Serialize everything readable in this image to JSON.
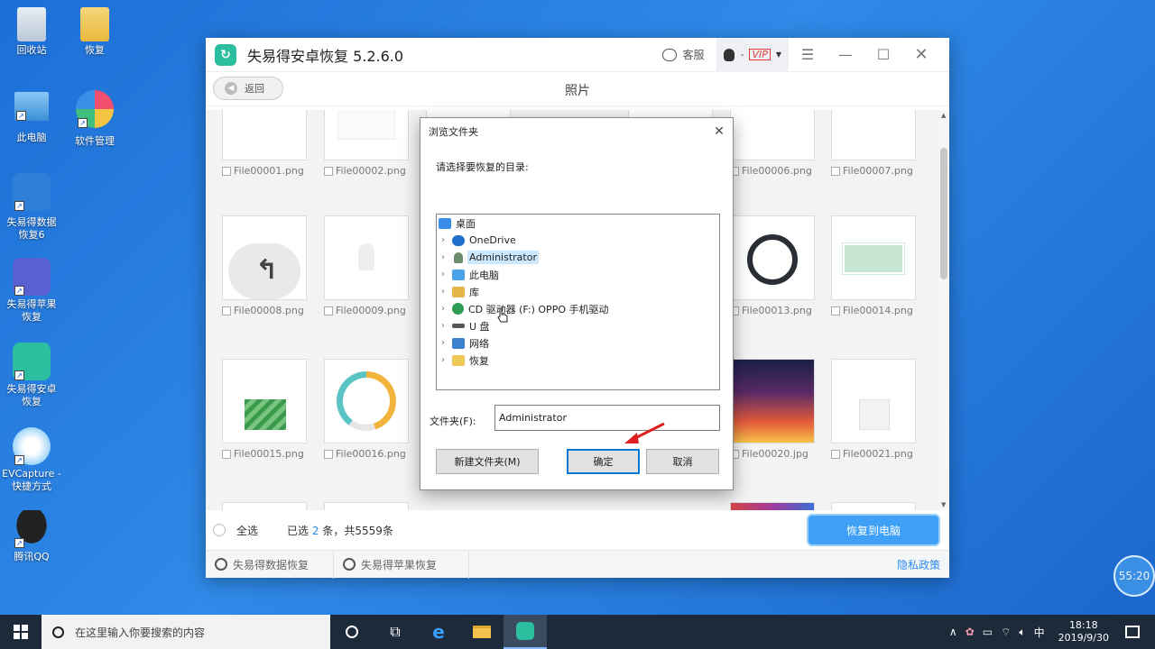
{
  "desktop": {
    "icons": [
      {
        "label": "回收站",
        "icon": "recycle-bin-icon"
      },
      {
        "label": "恢复",
        "icon": "folder-icon"
      },
      {
        "label": "此电脑",
        "icon": "computer-icon"
      },
      {
        "label": "软件管理",
        "icon": "software-manager-icon"
      },
      {
        "label": "失易得数据\n恢复6",
        "icon": "data-recovery-icon"
      },
      {
        "label": "失易得苹果\n恢复",
        "icon": "apple-recovery-icon"
      },
      {
        "label": "失易得安卓\n恢复",
        "icon": "android-recovery-icon"
      },
      {
        "label": "EVCapture -\n快捷方式",
        "icon": "evcapture-icon"
      },
      {
        "label": "腾讯QQ",
        "icon": "qq-icon"
      }
    ]
  },
  "app": {
    "title": "失易得安卓恢复  5.2.6.0",
    "service_label": "客服",
    "vip_label": "VIP",
    "user_dash": "-",
    "back_label": "返回",
    "page_title": "照片",
    "files": [
      "File00001.png",
      "File00002.png",
      "File00006.png",
      "File00007.png",
      "File00008.png",
      "File00009.png",
      "File00013.png",
      "File00014.png",
      "File00015.png",
      "File00016.png",
      "File00020.jpg",
      "File00021.png"
    ],
    "select_all_label": "全选",
    "selected_prefix": "已选",
    "selected_count": "2",
    "selected_suffix": "条，共5559条",
    "recover_button": "恢复到电脑",
    "footer_links": [
      "失易得数据恢复",
      "失易得苹果恢复"
    ],
    "privacy_label": "隐私政策"
  },
  "dialog": {
    "title": "浏览文件夹",
    "prompt": "请选择要恢复的目录:",
    "tree": [
      {
        "label": "桌面",
        "icon": "desktop-folder-icon",
        "color": "#3b8ee8",
        "has_arrow": false,
        "selected": false
      },
      {
        "label": "OneDrive",
        "icon": "cloud-icon",
        "color": "#1f6fcc",
        "has_arrow": true,
        "selected": false
      },
      {
        "label": "Administrator",
        "icon": "user-icon",
        "color": "#6b8e6b",
        "has_arrow": true,
        "selected": true
      },
      {
        "label": "此电脑",
        "icon": "computer-icon",
        "color": "#4aa3e8",
        "has_arrow": true,
        "selected": false
      },
      {
        "label": "库",
        "icon": "library-icon",
        "color": "#e3b547",
        "has_arrow": true,
        "selected": false
      },
      {
        "label": "CD 驱动器 (F:) OPPO 手机驱动",
        "icon": "cd-drive-icon",
        "color": "#2e9b55",
        "has_arrow": true,
        "selected": false
      },
      {
        "label": "U 盘",
        "icon": "usb-drive-icon",
        "color": "#555555",
        "has_arrow": true,
        "selected": false
      },
      {
        "label": "网络",
        "icon": "network-icon",
        "color": "#3f7fd0",
        "has_arrow": true,
        "selected": false
      },
      {
        "label": "恢复",
        "icon": "folder-icon",
        "color": "#f0c85a",
        "has_arrow": true,
        "selected": false
      }
    ],
    "folder_label": "文件夹(F):",
    "folder_value": "Administrator",
    "new_folder_button": "新建文件夹(M)",
    "ok_button": "确定",
    "cancel_button": "取消"
  },
  "timer": "55:20",
  "taskbar": {
    "search_placeholder": "在这里输入你要搜索的内容",
    "ime": "中",
    "time": "18:18",
    "date": "2019/9/30"
  }
}
